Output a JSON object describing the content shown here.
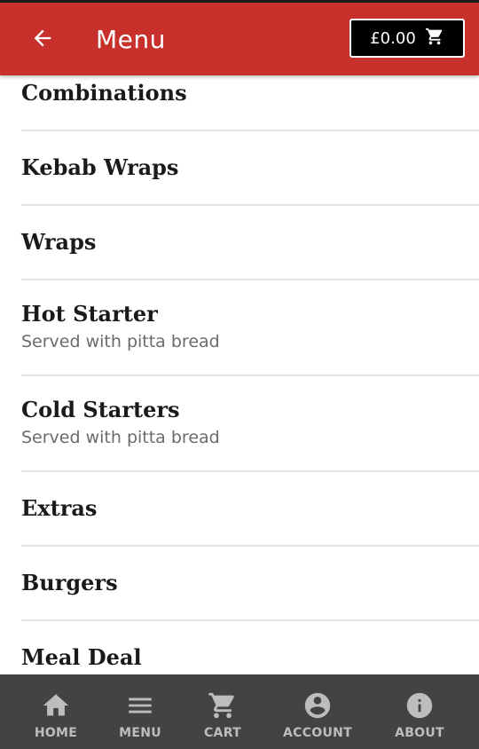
{
  "header": {
    "title": "Menu",
    "cart_total": "£0.00",
    "back_icon": "arrow-left-icon",
    "cart_icon": "shopping-cart-icon",
    "background_color": "#c8302b"
  },
  "menu": {
    "items": [
      {
        "name": "Combinations",
        "description": ""
      },
      {
        "name": "Kebab Wraps",
        "description": ""
      },
      {
        "name": "Wraps",
        "description": ""
      },
      {
        "name": "Hot Starter",
        "description": "Served with pitta bread"
      },
      {
        "name": "Cold Starters",
        "description": "Served with pitta bread"
      },
      {
        "name": "Extras",
        "description": ""
      },
      {
        "name": "Burgers",
        "description": ""
      },
      {
        "name": "Meal Deal",
        "description": ""
      }
    ]
  },
  "bottom_nav": {
    "background_color": "#434343",
    "items": [
      {
        "label": "HOME",
        "icon": "home-icon"
      },
      {
        "label": "MENU",
        "icon": "hamburger-menu-icon"
      },
      {
        "label": "CART",
        "icon": "shopping-cart-icon"
      },
      {
        "label": "ACCOUNT",
        "icon": "account-circle-icon"
      },
      {
        "label": "ABOUT",
        "icon": "info-icon"
      }
    ]
  }
}
